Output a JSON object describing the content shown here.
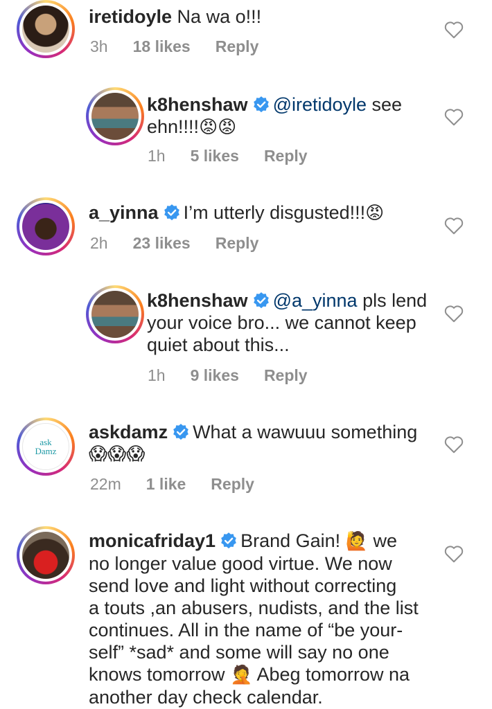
{
  "comments": [
    {
      "username": "iretidoyle",
      "verified": false,
      "text": " Na wa o!!!",
      "time": "3h",
      "likes": "18 likes",
      "reply": "Reply"
    },
    {
      "username": "k8henshaw",
      "verified": true,
      "mention": "@iretidoyle",
      "text_a": " see",
      "text_b": "ehn!!!!",
      "emoji": "😡😡",
      "time": "1h",
      "likes": "5 likes",
      "reply": "Reply"
    },
    {
      "username": "a_yinna",
      "verified": true,
      "text": "I’m utterly disgusted!!!",
      "emoji": "😡",
      "time": "2h",
      "likes": "23 likes",
      "reply": "Reply"
    },
    {
      "username": "k8henshaw",
      "verified": true,
      "mention": "@a_yinna",
      "text_a": " pls lend",
      "text_b": "your voice bro... we cannot keep",
      "text_c": "quiet about this...",
      "time": "1h",
      "likes": "9 likes",
      "reply": "Reply"
    },
    {
      "username": "askdamz",
      "verified": true,
      "text": "What a wawuuu something",
      "emoji": "😱😱😱",
      "avatar_text": "ask Damz",
      "time": "22m",
      "likes": "1 like",
      "reply": "Reply"
    },
    {
      "username": "monicafriday1",
      "verified": true,
      "text_a": "Brand Gain! ",
      "emoji_a": "🙋",
      "text_a2": " we",
      "lines": [
        "no longer value good virtue. We now",
        "send love and light without correcting",
        "a touts ,an abusers, nudists, and the list",
        "continues. All in the name of “be your-",
        "self” *sad* and some will say no one"
      ],
      "line_last_a": "knows tomorrow ",
      "emoji_b": "🤦",
      "line_last_b": " Abeg tomorrow na",
      "line_final": "another day check calendar."
    }
  ],
  "colors": {
    "verified": "#3897f0",
    "meta": "#8e8e8e",
    "mention": "#00376b"
  },
  "icons": [
    "verified-badge-icon",
    "heart-icon"
  ]
}
